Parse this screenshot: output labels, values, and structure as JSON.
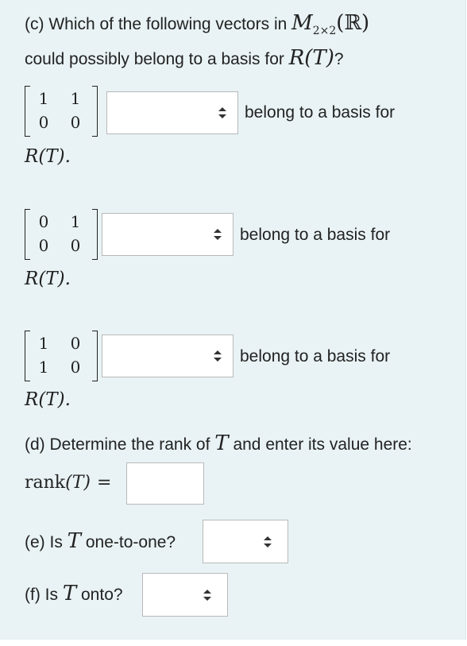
{
  "part_c": {
    "prefix": "(c) Which of the following vectors in ",
    "space_M": "M",
    "space_sub": "2×2",
    "space_field": "(ℝ)",
    "line2_text": "could possibly belong to a basis for ",
    "line2_math": "R(T)",
    "line2_end": "?",
    "items": [
      {
        "matrix": [
          "1",
          "1",
          "0",
          "0"
        ],
        "select_value": "",
        "suffix": "belong to a basis for",
        "after": "R(T)."
      },
      {
        "matrix": [
          "0",
          "1",
          "0",
          "0"
        ],
        "select_value": "",
        "suffix": "belong to a basis for",
        "after": "R(T)."
      },
      {
        "matrix": [
          "1",
          "0",
          "1",
          "0"
        ],
        "select_value": "",
        "suffix": "belong to a basis for",
        "after": "R(T)."
      }
    ]
  },
  "part_d": {
    "text_a": "(d) Determine the rank of ",
    "T": "T",
    "text_b": " and enter its value here:",
    "rank_label": "rank",
    "rank_arg": "(T)",
    "equals": "=",
    "input_value": ""
  },
  "part_e": {
    "text_a": "(e) Is ",
    "T": "T",
    "text_b": " one-to-one?",
    "select_value": ""
  },
  "part_f": {
    "text_a": "(f) Is ",
    "T": "T",
    "text_b": " onto?",
    "select_value": ""
  },
  "icons": {
    "select_arrows": "updown-arrows-icon"
  },
  "colors": {
    "panel": "#e9f3f5",
    "border": "#b9b9b9"
  }
}
